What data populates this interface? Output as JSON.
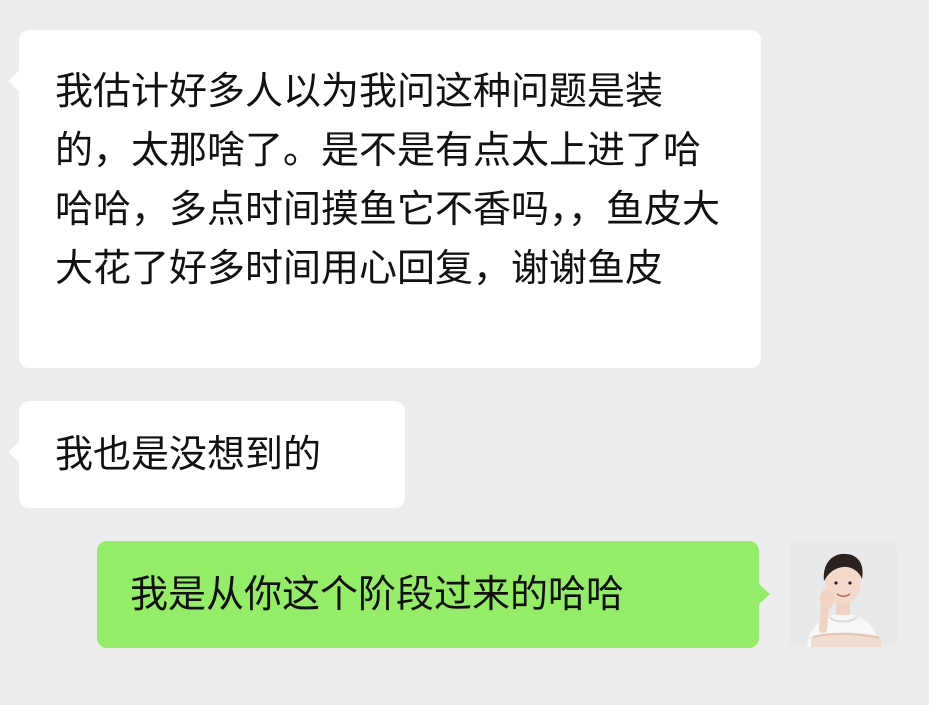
{
  "chat": {
    "messages": [
      {
        "direction": "incoming",
        "text": "我估计好多人以为我问这种问题是装的，太那啥了。是不是有点太上进了哈哈哈，多点时间摸鱼它不香吗，，鱼皮大大花了好多时间用心回复，谢谢鱼皮"
      },
      {
        "direction": "incoming",
        "text": "我也是没想到的"
      },
      {
        "direction": "outgoing",
        "text": "我是从你这个阶段过来的哈哈"
      }
    ],
    "self_avatar_icon": "user-avatar-photo",
    "colors": {
      "background": "#ededed",
      "incoming_bubble": "#ffffff",
      "outgoing_bubble": "#95ec69",
      "text": "#111111"
    }
  }
}
